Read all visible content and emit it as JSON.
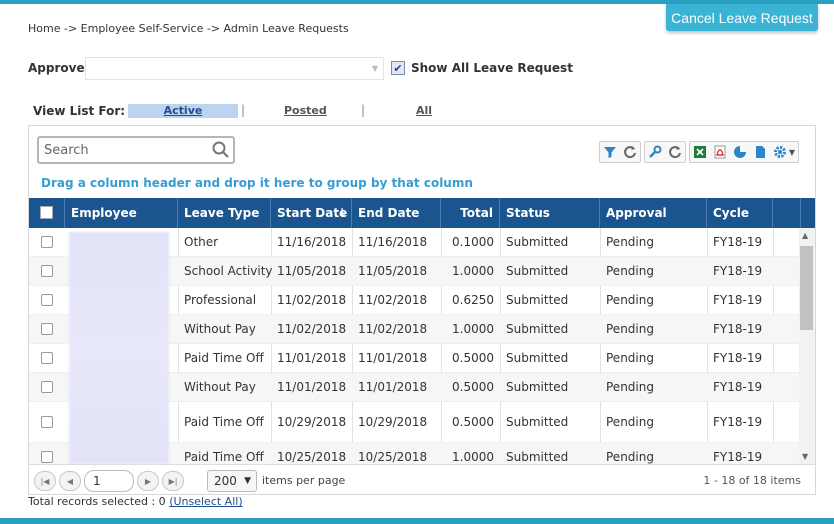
{
  "header": {
    "cancel_button": "Cancel Leave Request",
    "breadcrumb": "Home -> Employee Self-Service -> Admin Leave Requests"
  },
  "filters": {
    "approver_label": "Approver",
    "approver_value": "",
    "show_all_label": "Show All Leave Request",
    "show_all_checked": true,
    "view_list_label": "View List For:",
    "views": [
      "Active",
      "Posted",
      "All"
    ],
    "separator": "|"
  },
  "grid": {
    "search_placeholder": "Search",
    "group_hint": "Drag a column header and drop it here to group by that column",
    "columns": [
      "Employee",
      "Leave Type",
      "Start Date",
      "End Date",
      "Total",
      "Status Descri...",
      "Approval Status",
      "Cycle"
    ],
    "sort_indicator": "↓",
    "rows": [
      [
        "",
        "Other",
        "11/16/2018",
        "11/16/2018",
        "0.1000",
        "Submitted",
        "Pending",
        "FY18-19"
      ],
      [
        "",
        "School Activity",
        "11/05/2018",
        "11/05/2018",
        "1.0000",
        "Submitted",
        "Pending",
        "FY18-19"
      ],
      [
        "",
        "Professional",
        "11/02/2018",
        "11/02/2018",
        "0.6250",
        "Submitted",
        "Pending",
        "FY18-19"
      ],
      [
        "",
        "Without Pay",
        "11/02/2018",
        "11/02/2018",
        "1.0000",
        "Submitted",
        "Pending",
        "FY18-19"
      ],
      [
        "",
        "Paid Time Off",
        "11/01/2018",
        "11/01/2018",
        "0.5000",
        "Submitted",
        "Pending",
        "FY18-19"
      ],
      [
        "",
        "Without Pay",
        "11/01/2018",
        "11/01/2018",
        "0.5000",
        "Submitted",
        "Pending",
        "FY18-19"
      ],
      [
        "",
        "Paid Time Off",
        "10/29/2018",
        "10/29/2018",
        "0.5000",
        "Submitted",
        "Pending",
        "FY18-19"
      ],
      [
        "",
        "Paid Time Off",
        "10/25/2018",
        "10/25/2018",
        "1.0000",
        "Submitted",
        "Pending",
        "FY18-19"
      ]
    ]
  },
  "pager": {
    "current_page": "1",
    "page_size": "200",
    "items_per_page_label": "items per page",
    "range_text": "1 - 18 of 18 items"
  },
  "footer": {
    "total_records_text": "Total records selected : 0 ",
    "unselect_all": "(Unselect All)"
  },
  "colors": {
    "accent": "#3ab3d4",
    "header_bg": "#1a5590",
    "link": "#3a9ccf"
  },
  "icons": [
    "search-icon",
    "filter-icon",
    "refresh-icon",
    "wrench-icon",
    "excel-icon",
    "pdf-icon",
    "chart-icon",
    "document-icon",
    "gear-icon"
  ]
}
